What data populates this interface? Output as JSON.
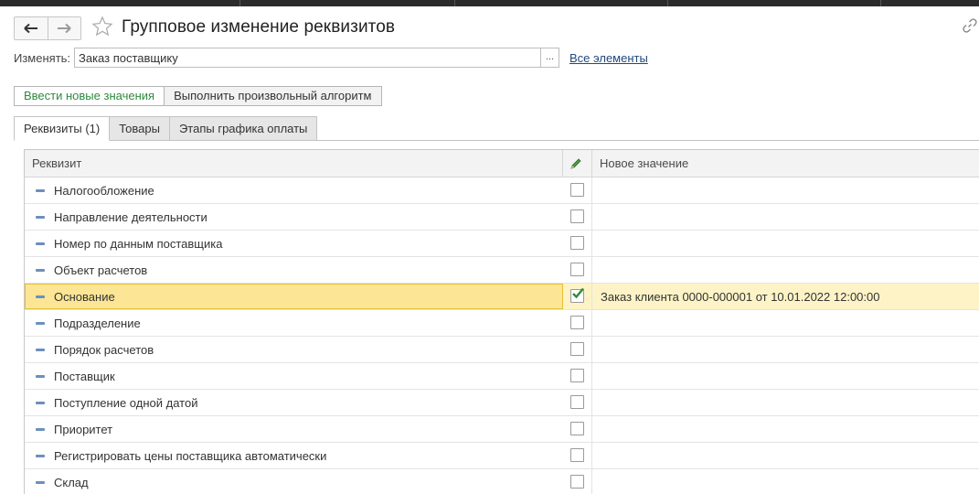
{
  "window": {
    "title": "Групповое изменение реквизитов"
  },
  "header": {
    "change_label": "Изменять:",
    "change_value": "Заказ поставщику",
    "select_btn": "...",
    "all_elements_link": "Все элементы"
  },
  "actions": {
    "enter_new_values": "Ввести новые значения",
    "run_algorithm": "Выполнить произвольный алгоритм"
  },
  "tabs": [
    {
      "label": "Реквизиты (1)",
      "active": true
    },
    {
      "label": "Товары",
      "active": false
    },
    {
      "label": "Этапы графика оплаты",
      "active": false
    }
  ],
  "grid": {
    "columns": {
      "attribute": "Реквизит",
      "new_value": "Новое значение"
    },
    "rows": [
      {
        "label": "Налогообложение",
        "checked": false,
        "value": ""
      },
      {
        "label": "Направление деятельности",
        "checked": false,
        "value": ""
      },
      {
        "label": "Номер по данным поставщика",
        "checked": false,
        "value": ""
      },
      {
        "label": "Объект расчетов",
        "checked": false,
        "value": ""
      },
      {
        "label": "Основание",
        "checked": true,
        "selected": true,
        "value": "Заказ клиента 0000-000001 от 10.01.2022 12:00:00"
      },
      {
        "label": "Подразделение",
        "checked": false,
        "value": ""
      },
      {
        "label": "Порядок расчетов",
        "checked": false,
        "value": ""
      },
      {
        "label": "Поставщик",
        "checked": false,
        "value": ""
      },
      {
        "label": "Поступление одной датой",
        "checked": false,
        "value": ""
      },
      {
        "label": "Приоритет",
        "checked": false,
        "value": ""
      },
      {
        "label": "Регистрировать цены поставщика автоматически",
        "checked": false,
        "value": ""
      },
      {
        "label": "Склад",
        "checked": false,
        "value": ""
      }
    ]
  },
  "colors": {
    "selected_row": "#fdf3c6",
    "selected_cell": "#fce595",
    "accent_green": "#2d8a3e",
    "link_blue": "#21497d"
  }
}
